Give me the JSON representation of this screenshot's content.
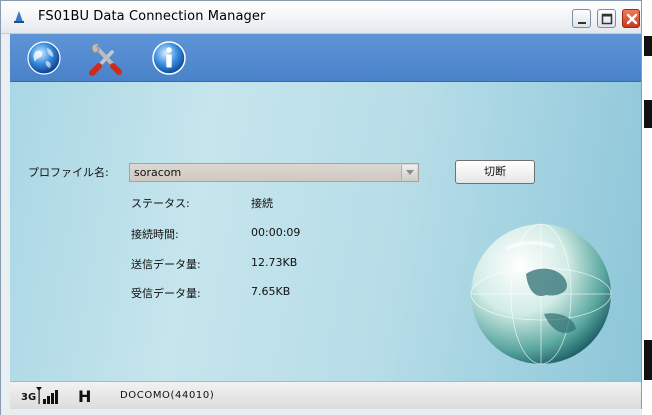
{
  "window": {
    "title": "FS01BU Data Connection Manager"
  },
  "toolbar": {
    "icons": [
      "globe-icon",
      "settings-icon",
      "info-icon"
    ]
  },
  "profile": {
    "label": "プロファイル名:",
    "selected": "soracom"
  },
  "actions": {
    "disconnect_label": "切断"
  },
  "status_rows": [
    {
      "label": "ステータス:",
      "value": "接続"
    },
    {
      "label": "接続時間:",
      "value": "00:00:09"
    },
    {
      "label": "送信データ量:",
      "value": "12.73KB"
    },
    {
      "label": "受信データ量:",
      "value": "7.65KB"
    }
  ],
  "statusbar": {
    "signal_type": "3G",
    "network": "H",
    "carrier": "DOCOMO(44010)"
  },
  "colors": {
    "toolbar": "#4a82c9",
    "content_bg": "#b7dde8",
    "close_button": "#c73a1d"
  }
}
